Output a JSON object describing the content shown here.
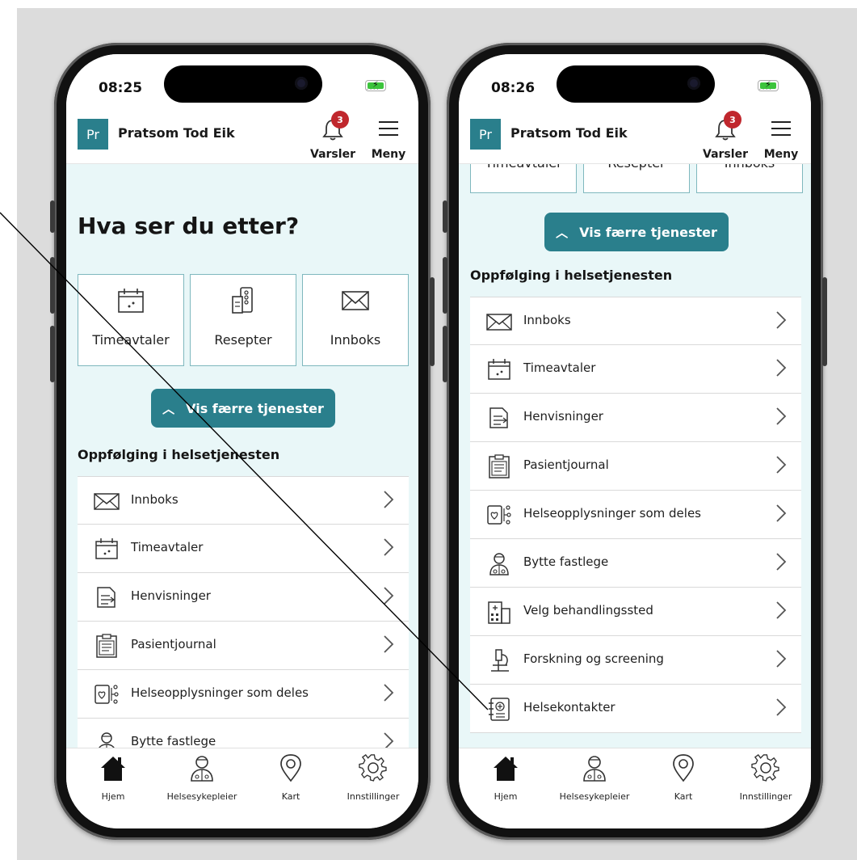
{
  "status": {
    "left_time": "08:25",
    "right_time": "08:26",
    "signal": "...."
  },
  "header": {
    "avatar_initials": "Pr",
    "user_name": "Pratsom Tod Eik",
    "alerts_label": "Varsler",
    "alerts_count": "3",
    "menu_label": "Meny"
  },
  "main": {
    "heading": "Hva ser du etter?",
    "tiles": [
      {
        "label": "Timeavtaler",
        "icon": "calendar-icon"
      },
      {
        "label": "Resepter",
        "icon": "prescription-icon"
      },
      {
        "label": "Innboks",
        "icon": "envelope-icon"
      }
    ],
    "toggle_services_label": "Vis færre tjenester",
    "section_title": "Oppfølging i helsetjenesten",
    "list_items": [
      {
        "label": "Innboks",
        "icon": "envelope-icon"
      },
      {
        "label": "Timeavtaler",
        "icon": "calendar-icon"
      },
      {
        "label": "Henvisninger",
        "icon": "referral-icon"
      },
      {
        "label": "Pasientjournal",
        "icon": "clipboard-icon"
      },
      {
        "label": "Helseopplysninger som deles",
        "icon": "shared-health-info-icon"
      },
      {
        "label": "Bytte fastlege",
        "icon": "doctor-icon"
      },
      {
        "label": "Velg behandlingssted",
        "icon": "hospital-icon"
      },
      {
        "label": "Forskning og screening",
        "icon": "microscope-icon"
      },
      {
        "label": "Helsekontakter",
        "icon": "contacts-book-icon"
      }
    ]
  },
  "tabbar": {
    "tabs": [
      {
        "label": "Hjem",
        "icon": "home-icon"
      },
      {
        "label": "Helsesykepleier",
        "icon": "nurse-icon"
      },
      {
        "label": "Kart",
        "icon": "map-pin-icon"
      },
      {
        "label": "Innstillinger",
        "icon": "gear-icon"
      }
    ]
  },
  "colors": {
    "accent": "#2a7f8c",
    "background": "#e9f7f8",
    "badge": "#c0272d"
  }
}
